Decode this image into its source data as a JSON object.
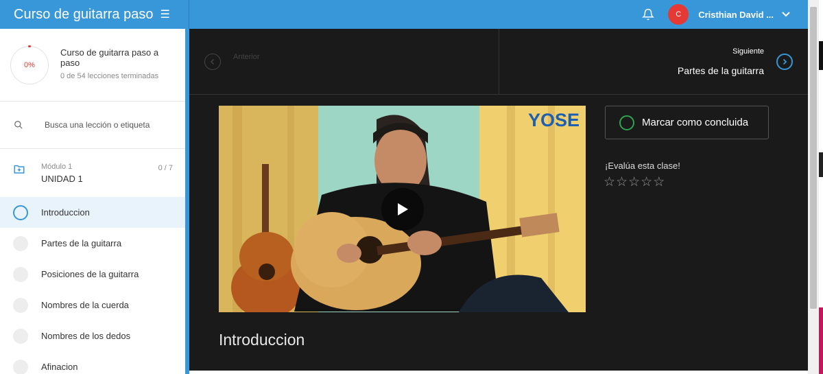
{
  "header": {
    "course_title": "Curso de guitarra paso",
    "menu_icon": "hamburger-icon",
    "bell_icon": "bell-icon",
    "avatar_initial": "C",
    "avatar_color": "#e53935",
    "user_name": "Cristhian David ...",
    "accent_color": "#3797d9"
  },
  "sidebar": {
    "progress_percent": "0%",
    "course_name": "Curso de guitarra paso a paso",
    "lessons_done": "0 de 54 lecciones terminadas",
    "search_placeholder": "Busca una lección o etiqueta",
    "module": {
      "label": "Módulo 1",
      "name": "UNIDAD 1",
      "count": "0 / 7"
    },
    "lessons": [
      {
        "name": "Introduccion",
        "active": true
      },
      {
        "name": "Partes de la guitarra",
        "active": false
      },
      {
        "name": "Posiciones de la guitarra",
        "active": false
      },
      {
        "name": "Nombres de la cuerda",
        "active": false
      },
      {
        "name": "Nombres de los dedos",
        "active": false
      },
      {
        "name": "Afinacion",
        "active": false
      }
    ]
  },
  "main": {
    "prev_label": "Anterior",
    "next_label": "Siguiente",
    "next_title": "Partes de la guitarra",
    "video_logo": "YOSE",
    "complete_label": "Marcar como concluida",
    "rate_label": "¡Evalúa esta clase!",
    "stars": [
      "☆",
      "☆",
      "☆",
      "☆",
      "☆"
    ],
    "lesson_title": "Introduccion"
  }
}
